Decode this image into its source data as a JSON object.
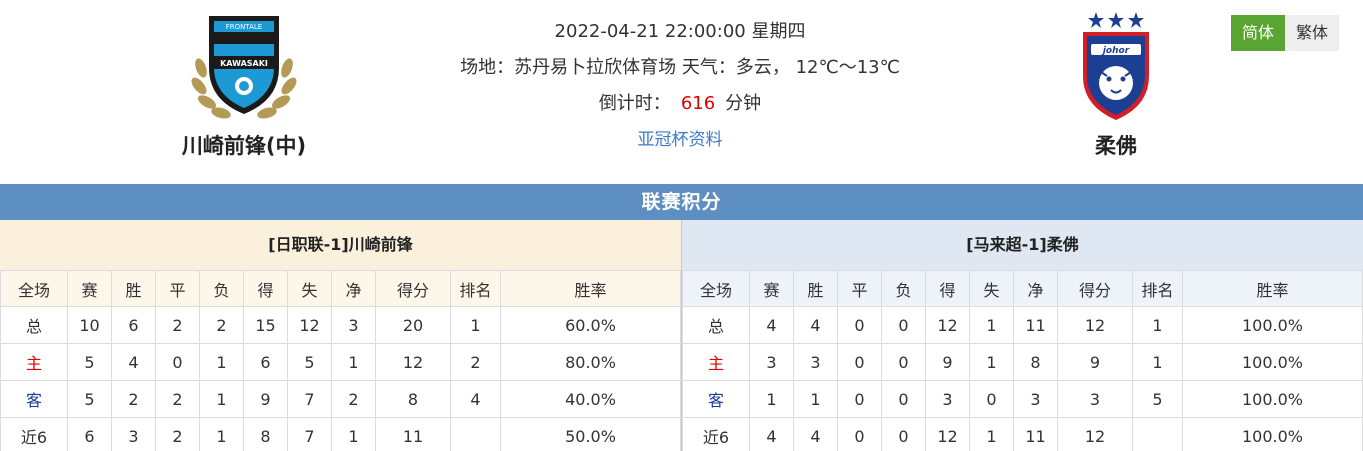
{
  "match": {
    "datetime": "2022-04-21 22:00:00 星期四",
    "venue_weather": "场地：苏丹易卜拉欣体育场 天气：多云， 12℃～13℃",
    "countdown_label": "倒计时：",
    "countdown_value": "616",
    "countdown_unit": "分钟",
    "link_label": "亚冠杯资料"
  },
  "home_team": {
    "name": "川崎前锋(中)",
    "logo_text_top": "FRONTALE",
    "logo_text_main": "KAWASAKI",
    "logo_colors": {
      "primary": "#1d9ad6",
      "dark": "#1a1a1a",
      "gold": "#b59a55"
    }
  },
  "away_team": {
    "name": "柔佛",
    "logo_text": "johor",
    "logo_colors": {
      "primary": "#1c3f94",
      "accent": "#d21f26",
      "star": "#1c3f94"
    }
  },
  "language": {
    "simplified": "简体",
    "traditional": "繁体",
    "active": "simplified"
  },
  "section_title": "联赛积分",
  "columns": [
    "全场",
    "赛",
    "胜",
    "平",
    "负",
    "得",
    "失",
    "净",
    "得分",
    "排名",
    "胜率"
  ],
  "home_standings": {
    "title": "[日职联-1]川崎前锋",
    "rows": [
      [
        "总",
        "10",
        "6",
        "2",
        "2",
        "15",
        "12",
        "3",
        "20",
        "1",
        "60.0%"
      ],
      [
        "主",
        "5",
        "4",
        "0",
        "1",
        "6",
        "5",
        "1",
        "12",
        "2",
        "80.0%"
      ],
      [
        "客",
        "5",
        "2",
        "2",
        "1",
        "9",
        "7",
        "2",
        "8",
        "4",
        "40.0%"
      ],
      [
        "近6",
        "6",
        "3",
        "2",
        "1",
        "8",
        "7",
        "1",
        "11",
        "",
        "50.0%"
      ]
    ]
  },
  "away_standings": {
    "title": "[马来超-1]柔佛",
    "rows": [
      [
        "总",
        "4",
        "4",
        "0",
        "0",
        "12",
        "1",
        "11",
        "12",
        "1",
        "100.0%"
      ],
      [
        "主",
        "3",
        "3",
        "0",
        "0",
        "9",
        "1",
        "8",
        "9",
        "1",
        "100.0%"
      ],
      [
        "客",
        "1",
        "1",
        "0",
        "0",
        "3",
        "0",
        "3",
        "3",
        "5",
        "100.0%"
      ],
      [
        "近6",
        "4",
        "4",
        "0",
        "0",
        "12",
        "1",
        "11",
        "12",
        "",
        "100.0%"
      ]
    ]
  },
  "colors": {
    "section_header": "#5e8fc3",
    "home_red": "#e00000",
    "away_blue": "#1a3d9c",
    "lang_active": "#5aa532"
  }
}
